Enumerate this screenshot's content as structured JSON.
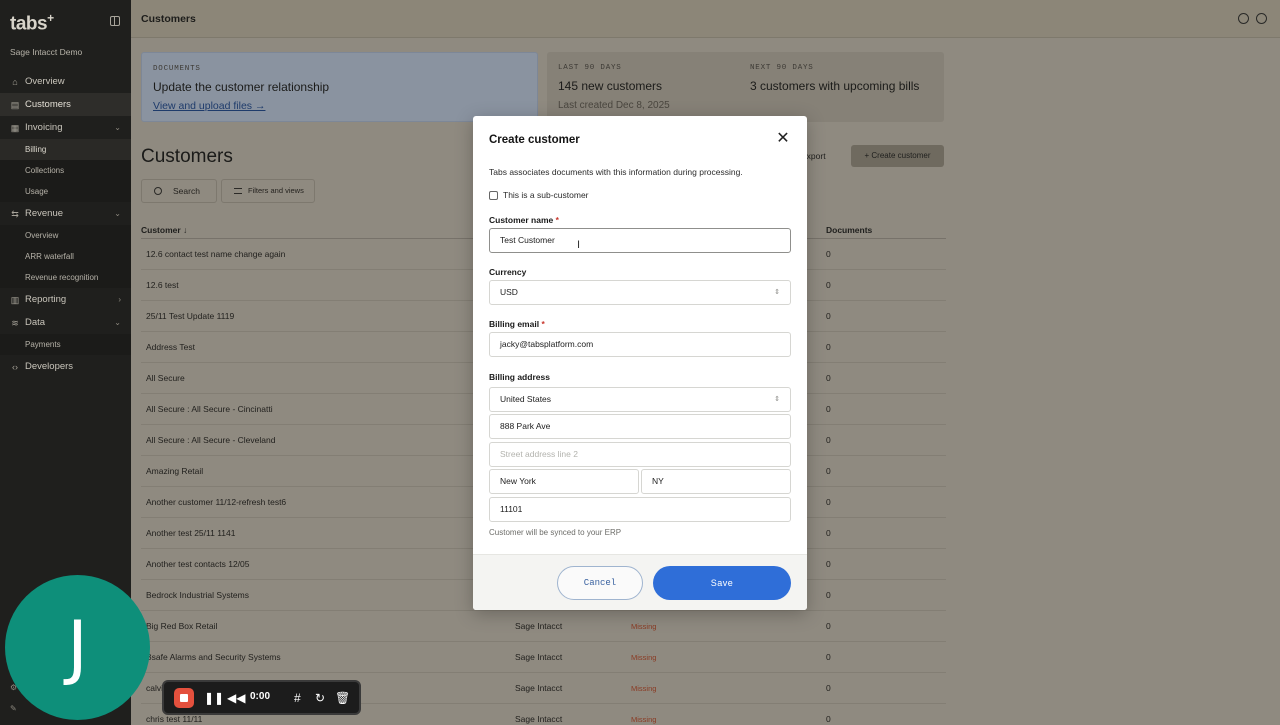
{
  "app": {
    "logo": "tabs",
    "org": "Sage Intacct Demo"
  },
  "nav": {
    "overview": "Overview",
    "customers": "Customers",
    "invoicing": "Invoicing",
    "billing": "Billing",
    "collections": "Collections",
    "usage": "Usage",
    "revenue": "Revenue",
    "rev_overview": "Overview",
    "arr_waterfall": "ARR waterfall",
    "revenue_recognition": "Revenue recognition",
    "reporting": "Reporting",
    "data": "Data",
    "payments": "Payments",
    "developers": "Developers"
  },
  "topbar": {
    "title": "Customers"
  },
  "cards": {
    "documents": {
      "kicker": "DOCUMENTS",
      "text": "Update the customer relationship",
      "link": "View and upload files →"
    },
    "last90": {
      "kicker": "LAST 90 DAYS",
      "text": "145 new customers",
      "sub": "Last created Dec 8, 2025"
    },
    "next90": {
      "kicker": "NEXT 90 DAYS",
      "text": "3 customers with upcoming bills"
    }
  },
  "page": {
    "title": "Customers",
    "export": "Export",
    "create": "+ Create customer",
    "search": "Search",
    "filters": "Filters and views"
  },
  "table": {
    "headers": {
      "customer": "Customer ↓",
      "documents": "Documents"
    },
    "rows": [
      {
        "name": "12.6 contact test name change again",
        "erp": "",
        "status": "",
        "docs": "0"
      },
      {
        "name": "12.6 test",
        "erp": "",
        "status": "",
        "docs": "0"
      },
      {
        "name": "25/11 Test Update 1119",
        "erp": "",
        "status": "",
        "docs": "0"
      },
      {
        "name": "Address Test",
        "erp": "",
        "status": "",
        "docs": "0"
      },
      {
        "name": "All Secure",
        "erp": "",
        "status": "",
        "docs": "0"
      },
      {
        "name": "All Secure : All Secure - Cincinatti",
        "erp": "",
        "status": "",
        "docs": "0"
      },
      {
        "name": "All Secure : All Secure - Cleveland",
        "erp": "",
        "status": "",
        "docs": "0"
      },
      {
        "name": "Amazing Retail",
        "erp": "",
        "status": "",
        "docs": "0"
      },
      {
        "name": "Another customer 11/12-refresh test6",
        "erp": "",
        "status": "",
        "docs": "0"
      },
      {
        "name": "Another test 25/11 1141",
        "erp": "",
        "status": "",
        "docs": "0"
      },
      {
        "name": "Another test contacts 12/05",
        "erp": "",
        "status": "",
        "docs": "0"
      },
      {
        "name": "Bedrock Industrial Systems",
        "erp": "",
        "status": "",
        "docs": "0"
      },
      {
        "name": "Big Red Box Retail",
        "erp": "Sage Intacct",
        "status": "Missing",
        "docs": "0"
      },
      {
        "name": "Bsafe Alarms and Security Systems",
        "erp": "Sage Intacct",
        "status": "Missing",
        "docs": "0"
      },
      {
        "name": "calvi",
        "erp": "Sage Intacct",
        "status": "Missing",
        "docs": "0"
      },
      {
        "name": "chris test 11/11",
        "erp": "Sage Intacct",
        "status": "Missing",
        "docs": "0"
      }
    ]
  },
  "modal": {
    "title": "Create customer",
    "description": "Tabs associates documents with this information during processing.",
    "sub_customer_label": "This is a sub-customer",
    "name_label": "Customer name",
    "name_value": "Test Customer",
    "currency_label": "Currency",
    "currency_value": "USD",
    "email_label": "Billing email",
    "email_value": "jacky@tabsplatform.com",
    "address_label": "Billing address",
    "country": "United States",
    "street1": "888 Park Ave",
    "street2_placeholder": "Street address line 2",
    "city": "New York",
    "state": "NY",
    "zip": "11101",
    "note": "Customer will be synced to your ERP",
    "cancel": "Cancel",
    "save": "Save",
    "required_mark": "*"
  },
  "recorder": {
    "avatar_letter": "J",
    "time": "0:00"
  },
  "colors": {
    "accent": "#2f6ed8",
    "avatar": "#0e8f7a",
    "record": "#e4503d"
  }
}
